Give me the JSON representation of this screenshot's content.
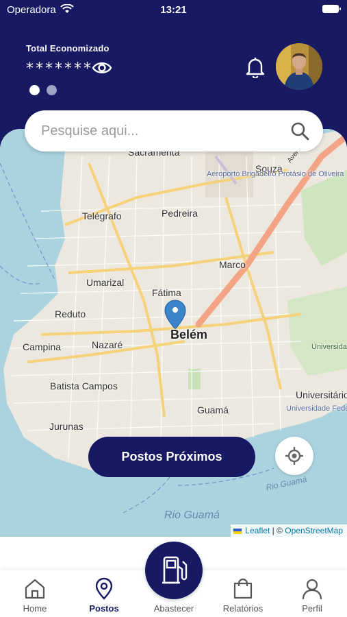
{
  "status_bar": {
    "carrier": "Operadora",
    "time": "13:21"
  },
  "header": {
    "savings_label": "Total Economizado",
    "savings_value": "*******",
    "icons": {
      "eye": "eye-icon",
      "bell": "bell-icon"
    }
  },
  "search": {
    "placeholder": "Pesquise aqui...",
    "value": ""
  },
  "map": {
    "labels": {
      "sacramenta": "Sacramenta",
      "souza": "Souza",
      "aeroporto": "Aeroporto Brigadeiro Protásio de Oliveira",
      "avenida": "Avenida Júlio César",
      "telegrafo": "Telégrafo",
      "pedreira": "Pedreira",
      "marco": "Marco",
      "umarizal": "Umarizal",
      "fatima": "Fátima",
      "reduto": "Reduto",
      "belem": "Belém",
      "campina": "Campina",
      "nazare": "Nazaré",
      "universidade_federal_rural": "Universidade Federal Rural da Amazônia",
      "batista_campos": "Batista Campos",
      "universitario": "Universitário",
      "guama": "Guamá",
      "universidade_federal_para": "Universidade Federal do Pará",
      "jurunas": "Jurunas",
      "rio_guama_small": "Rio Guamá",
      "rio_guama": "Rio Guamá"
    },
    "attribution": {
      "leaflet": "Leaflet",
      "separator": "| ©",
      "osm": "OpenStreetMap"
    },
    "nearby_button": "Postos Próximos"
  },
  "tabs": [
    {
      "label": "Home",
      "icon": "home-icon"
    },
    {
      "label": "Postos",
      "icon": "map-pin-icon",
      "active": true
    },
    {
      "label": "Abastecer",
      "icon": "fuel-pump-icon"
    },
    {
      "label": "Relatórios",
      "icon": "shopping-bag-icon"
    },
    {
      "label": "Perfil",
      "icon": "user-icon"
    }
  ],
  "colors": {
    "brand": "#171a63",
    "water": "#aad3df",
    "road_major": "#f5d27a",
    "road_primary": "#f3a484"
  }
}
